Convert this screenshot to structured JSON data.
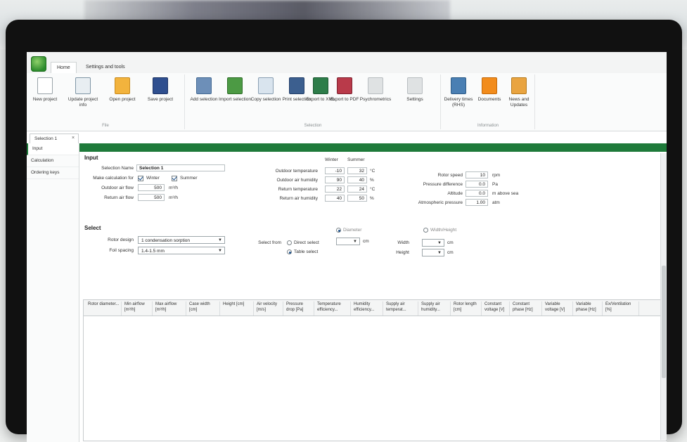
{
  "ribbon": {
    "tabs": [
      "Home",
      "Settings and tools"
    ],
    "groups": [
      {
        "label": "File",
        "buttons": [
          {
            "label": "New project",
            "icon": "new-document-icon"
          },
          {
            "label": "Update project info",
            "icon": "edit-document-icon"
          },
          {
            "label": "Open project",
            "icon": "open-folder-icon"
          },
          {
            "label": "Save project",
            "icon": "save-disk-icon"
          }
        ]
      },
      {
        "label": "Selection",
        "buttons": [
          {
            "label": "Add selection",
            "icon": "add-selection-icon"
          },
          {
            "label": "Import selection",
            "icon": "import-icon"
          },
          {
            "label": "Copy selection",
            "icon": "copy-icon"
          },
          {
            "label": "Print selection",
            "icon": "print-icon"
          },
          {
            "label": "Export to XML",
            "icon": "export-xml-icon"
          },
          {
            "label": "Export to PDF",
            "icon": "export-pdf-icon"
          },
          {
            "label": "Psychrometrics",
            "icon": "psychrometrics-icon"
          },
          {
            "label": "Settings",
            "icon": "settings-icon"
          }
        ]
      },
      {
        "label": "Information",
        "buttons": [
          {
            "label": "Delivery times (RHS)",
            "icon": "delivery-truck-icon"
          },
          {
            "label": "Documents",
            "icon": "documents-icon"
          },
          {
            "label": "News and Updates",
            "icon": "news-icon"
          }
        ]
      }
    ]
  },
  "doc_tab": {
    "label": "Selection 1"
  },
  "left_rail": [
    "Input",
    "Calculation",
    "Ordering keys"
  ],
  "input": {
    "title": "Input",
    "selection_name_label": "Selection Name",
    "selection_name_value": "Selection 1",
    "make_calc_label": "Make calculation for",
    "winter_label": "Winter",
    "summer_label": "Summer",
    "outdoor_air_flow_label": "Outdoor air flow",
    "outdoor_air_flow_value": "500",
    "return_air_flow_label": "Return air flow",
    "return_air_flow_value": "500",
    "air_flow_unit": "m³/h",
    "col_winter": "Winter",
    "col_summer": "Summer",
    "conditions": [
      {
        "label": "Outdoor temperature",
        "winter": "-10",
        "summer": "32",
        "unit": "°C"
      },
      {
        "label": "Outdoor air humidity",
        "winter": "90",
        "summer": "40",
        "unit": "%"
      },
      {
        "label": "Return temperature",
        "winter": "22",
        "summer": "24",
        "unit": "°C"
      },
      {
        "label": "Return air humidity",
        "winter": "40",
        "summer": "50",
        "unit": "%"
      }
    ],
    "rotor_speed_label": "Rotor speed",
    "rotor_speed_value": "10",
    "rotor_speed_unit": "rpm",
    "pressure_diff_label": "Pressure difference",
    "pressure_diff_value": "0.0",
    "pressure_diff_unit": "Pa",
    "altitude_label": "Altitude",
    "altitude_value": "0.0",
    "altitude_unit": "m above sea",
    "atm_pressure_label": "Atmospheric pressure",
    "atm_pressure_value": "1.00",
    "atm_pressure_unit": "atm"
  },
  "select": {
    "title": "Select",
    "rotor_design_label": "Rotor design",
    "rotor_design_value": "1 condensation sorption",
    "foil_spacing_label": "Foil spacing",
    "foil_spacing_value": "1.4-1.5 mm",
    "select_from_label": "Select from",
    "direct_select_label": "Direct select",
    "table_select_label": "Table select",
    "diameter_label": "Diameter",
    "width_height_label": "Width/Height",
    "width_label": "Width",
    "height_label": "Height",
    "cm_unit": "cm"
  },
  "table": {
    "columns": [
      "Rotor diameter...",
      "Min airflow [m³/h]",
      "Max airflow [m³/h]",
      "Case width [cm]",
      "Height [cm]",
      "Air velocity [m/s]",
      "Pressure drop [Pa]",
      "Temperature efficiency...",
      "Humidity efficiency...",
      "Supply air temperat...",
      "Supply air humidity...",
      "Rotor length [cm]",
      "Constant voltage [V]",
      "Constant phase [Hz]",
      "Variable voltage [V]",
      "Variable phase [Hz]",
      "Ex/Ventilation [%]"
    ],
    "rows": []
  },
  "colors": {
    "accent": "#1e7a3a",
    "bezel": "#111111"
  }
}
